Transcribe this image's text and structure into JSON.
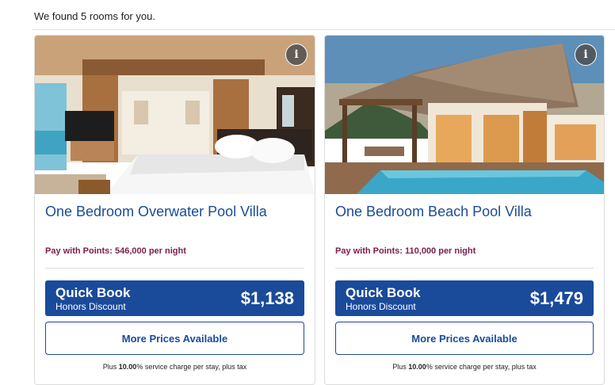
{
  "results": {
    "count_text": "We found 5 rooms for you."
  },
  "rooms": [
    {
      "name": "One Bedroom Overwater Pool Villa",
      "points_text": "Pay with Points: 546,000 per night",
      "quick_book_title": "Quick Book",
      "quick_book_subtitle": "Honors Discount",
      "price": "$1,138",
      "more_prices_label": "More Prices Available",
      "service_prefix": "Plus ",
      "service_pct": "10.00",
      "service_suffix": "% service charge per stay, plus tax",
      "info_label": "i"
    },
    {
      "name": "One Bedroom Beach Pool Villa",
      "points_text": "Pay with Points: 110,000 per night",
      "quick_book_title": "Quick Book",
      "quick_book_subtitle": "Honors Discount",
      "price": "$1,479",
      "more_prices_label": "More Prices Available",
      "service_prefix": "Plus ",
      "service_pct": "10.00",
      "service_suffix": "% service charge per stay, plus tax",
      "info_label": "i"
    }
  ],
  "colors": {
    "brand_blue": "#1a4a9a",
    "room_name_blue": "#1c4c94",
    "points_maroon": "#7a1e4e"
  }
}
